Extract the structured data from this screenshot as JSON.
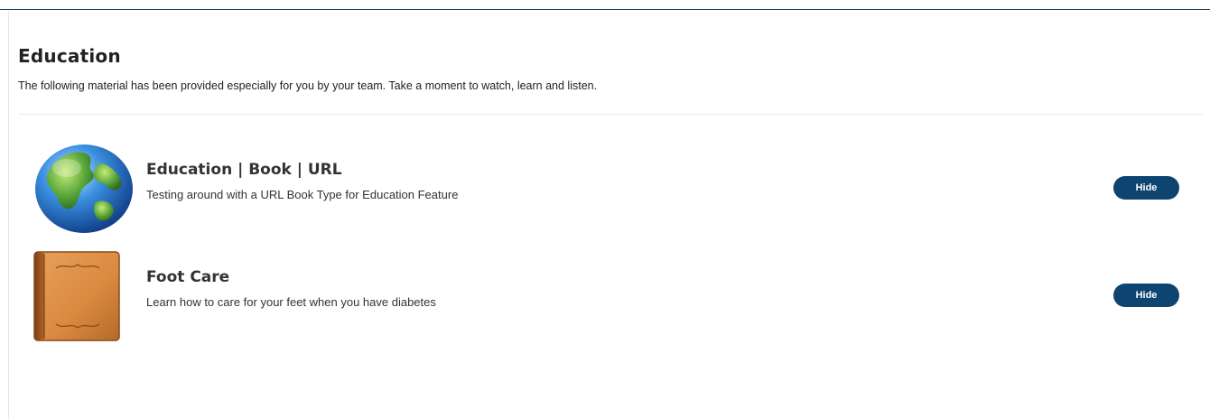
{
  "section": {
    "title": "Education",
    "subtitle": "The following material has been provided especially for you by your team. Take a moment to watch, learn and listen."
  },
  "items": [
    {
      "icon": "globe-icon",
      "title": "Education | Book | URL",
      "description": "Testing around with a URL Book Type for Education Feature",
      "action_label": "Hide"
    },
    {
      "icon": "book-icon",
      "title": "Foot Care",
      "description": "Learn how to care for your feet when you have diabetes",
      "action_label": "Hide"
    }
  ],
  "colors": {
    "button_bg": "#0d4470",
    "top_border": "#1e3d5c",
    "book_cover": "#d9893f",
    "globe_ocean": "#2f7fd6",
    "globe_land": "#5aa63a"
  }
}
